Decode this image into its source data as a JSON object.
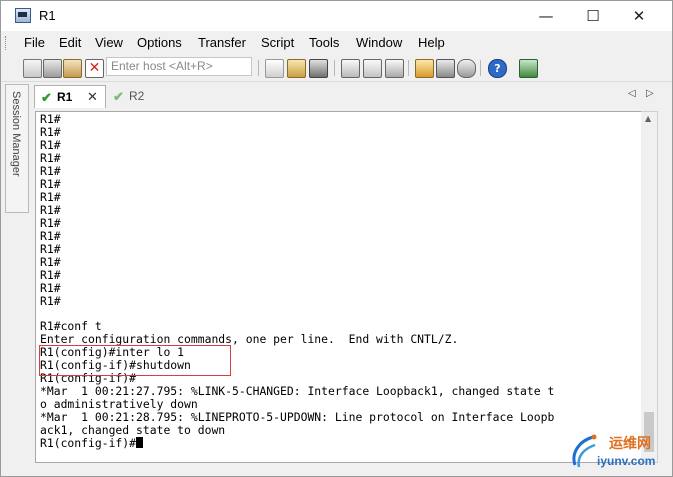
{
  "window": {
    "title": "R1"
  },
  "title_buttons": {
    "minimize": "—",
    "maximize": "☐",
    "close": "✕"
  },
  "menu": [
    "File",
    "Edit",
    "View",
    "Options",
    "Transfer",
    "Script",
    "Tools",
    "Window",
    "Help"
  ],
  "toolbar": {
    "host_placeholder": "Enter host <Alt+R>"
  },
  "sidebar": {
    "label": "Session Manager"
  },
  "tabs": [
    {
      "label": "R1",
      "close": "✕"
    },
    {
      "label": "R2"
    }
  ],
  "tab_nav": {
    "left": "◁",
    "right": "▷"
  },
  "terminal": {
    "lines": [
      "R1#",
      "R1#",
      "R1#",
      "R1#",
      "R1#",
      "R1#",
      "R1#",
      "R1#",
      "R1#",
      "R1#",
      "R1#",
      "R1#",
      "R1#",
      "R1#",
      "R1#",
      "R1#conf t",
      "Enter configuration commands, one per line.  End with CNTL/Z.",
      "R1(config)#inter lo 1",
      "R1(config-if)#shutdown",
      "R1(config-if)#",
      "*Mar  1 00:21:27.795: %LINK-5-CHANGED: Interface Loopback1, changed state t",
      "o administratively down",
      "*Mar  1 00:21:28.795: %LINEPROTO-5-UPDOWN: Line protocol on Interface Loopb",
      "ack1, changed state to down"
    ],
    "prompt": "R1(config-if)#"
  },
  "watermark": {
    "brand": "运维网",
    "url": "iyunv.com"
  },
  "colors": {
    "highlight_box": "#e03a3a",
    "tab_check": "#2e9b2e"
  }
}
